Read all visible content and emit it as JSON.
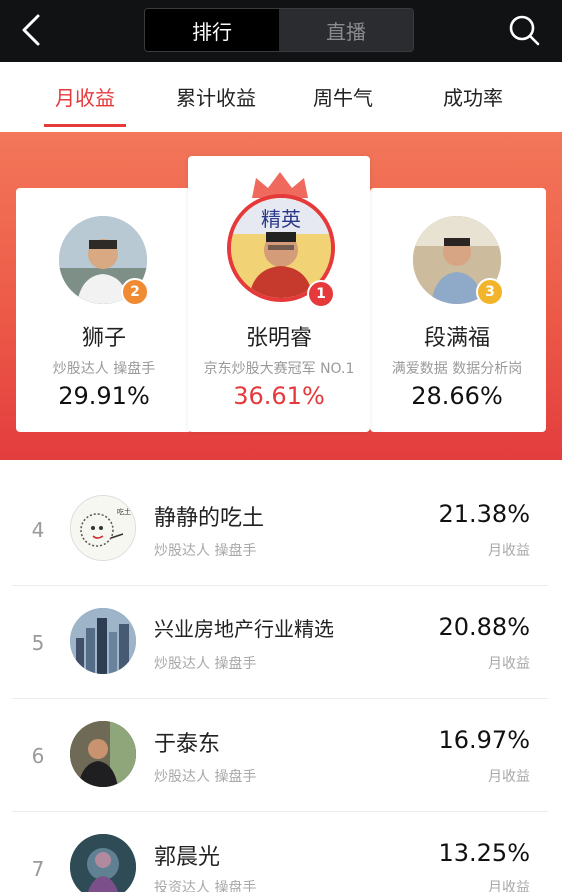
{
  "header": {
    "segments": [
      {
        "label": "排行",
        "active": true
      },
      {
        "label": "直播",
        "active": false
      }
    ]
  },
  "tabs": [
    {
      "label": "月收益",
      "active": true
    },
    {
      "label": "累计收益",
      "active": false
    },
    {
      "label": "周牛气",
      "active": false
    },
    {
      "label": "成功率",
      "active": false
    }
  ],
  "podium": [
    {
      "rank": "2",
      "name": "狮子",
      "title": "炒股达人 操盘手",
      "return": "29.91%",
      "badge_color": "#f08a33"
    },
    {
      "rank": "1",
      "name": "张明睿",
      "title": "京东炒股大赛冠军 NO.1",
      "return": "36.61%",
      "badge_color": "#e5393c"
    },
    {
      "rank": "3",
      "name": "段满福",
      "title": "满爱数据 数据分析岗",
      "return": "28.66%",
      "badge_color": "#f2b42a"
    }
  ],
  "list": [
    {
      "rank": "4",
      "name": "静静的吃土",
      "title": "炒股达人 操盘手",
      "return": "21.38%",
      "metric": "月收益"
    },
    {
      "rank": "5",
      "name": "兴业房地产行业精选",
      "title": "炒股达人 操盘手",
      "return": "20.88%",
      "metric": "月收益"
    },
    {
      "rank": "6",
      "name": "于泰东",
      "title": "炒股达人 操盘手",
      "return": "16.97%",
      "metric": "月收益"
    },
    {
      "rank": "7",
      "name": "郭晨光",
      "title": "投资达人 操盘手",
      "return": "13.25%",
      "metric": "月收益"
    }
  ],
  "colors": {
    "accent": "#e5393c",
    "header_bg": "#111214"
  },
  "icons": {
    "back": "chevron-left-icon",
    "search": "search-icon",
    "crown": "crown-icon"
  }
}
